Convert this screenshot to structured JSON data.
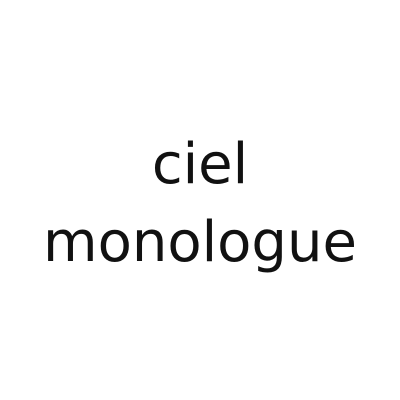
{
  "text": {
    "line1": "ciel",
    "line2": "monologue"
  },
  "colors": {
    "background": "#ffffff",
    "text": "#111111"
  }
}
